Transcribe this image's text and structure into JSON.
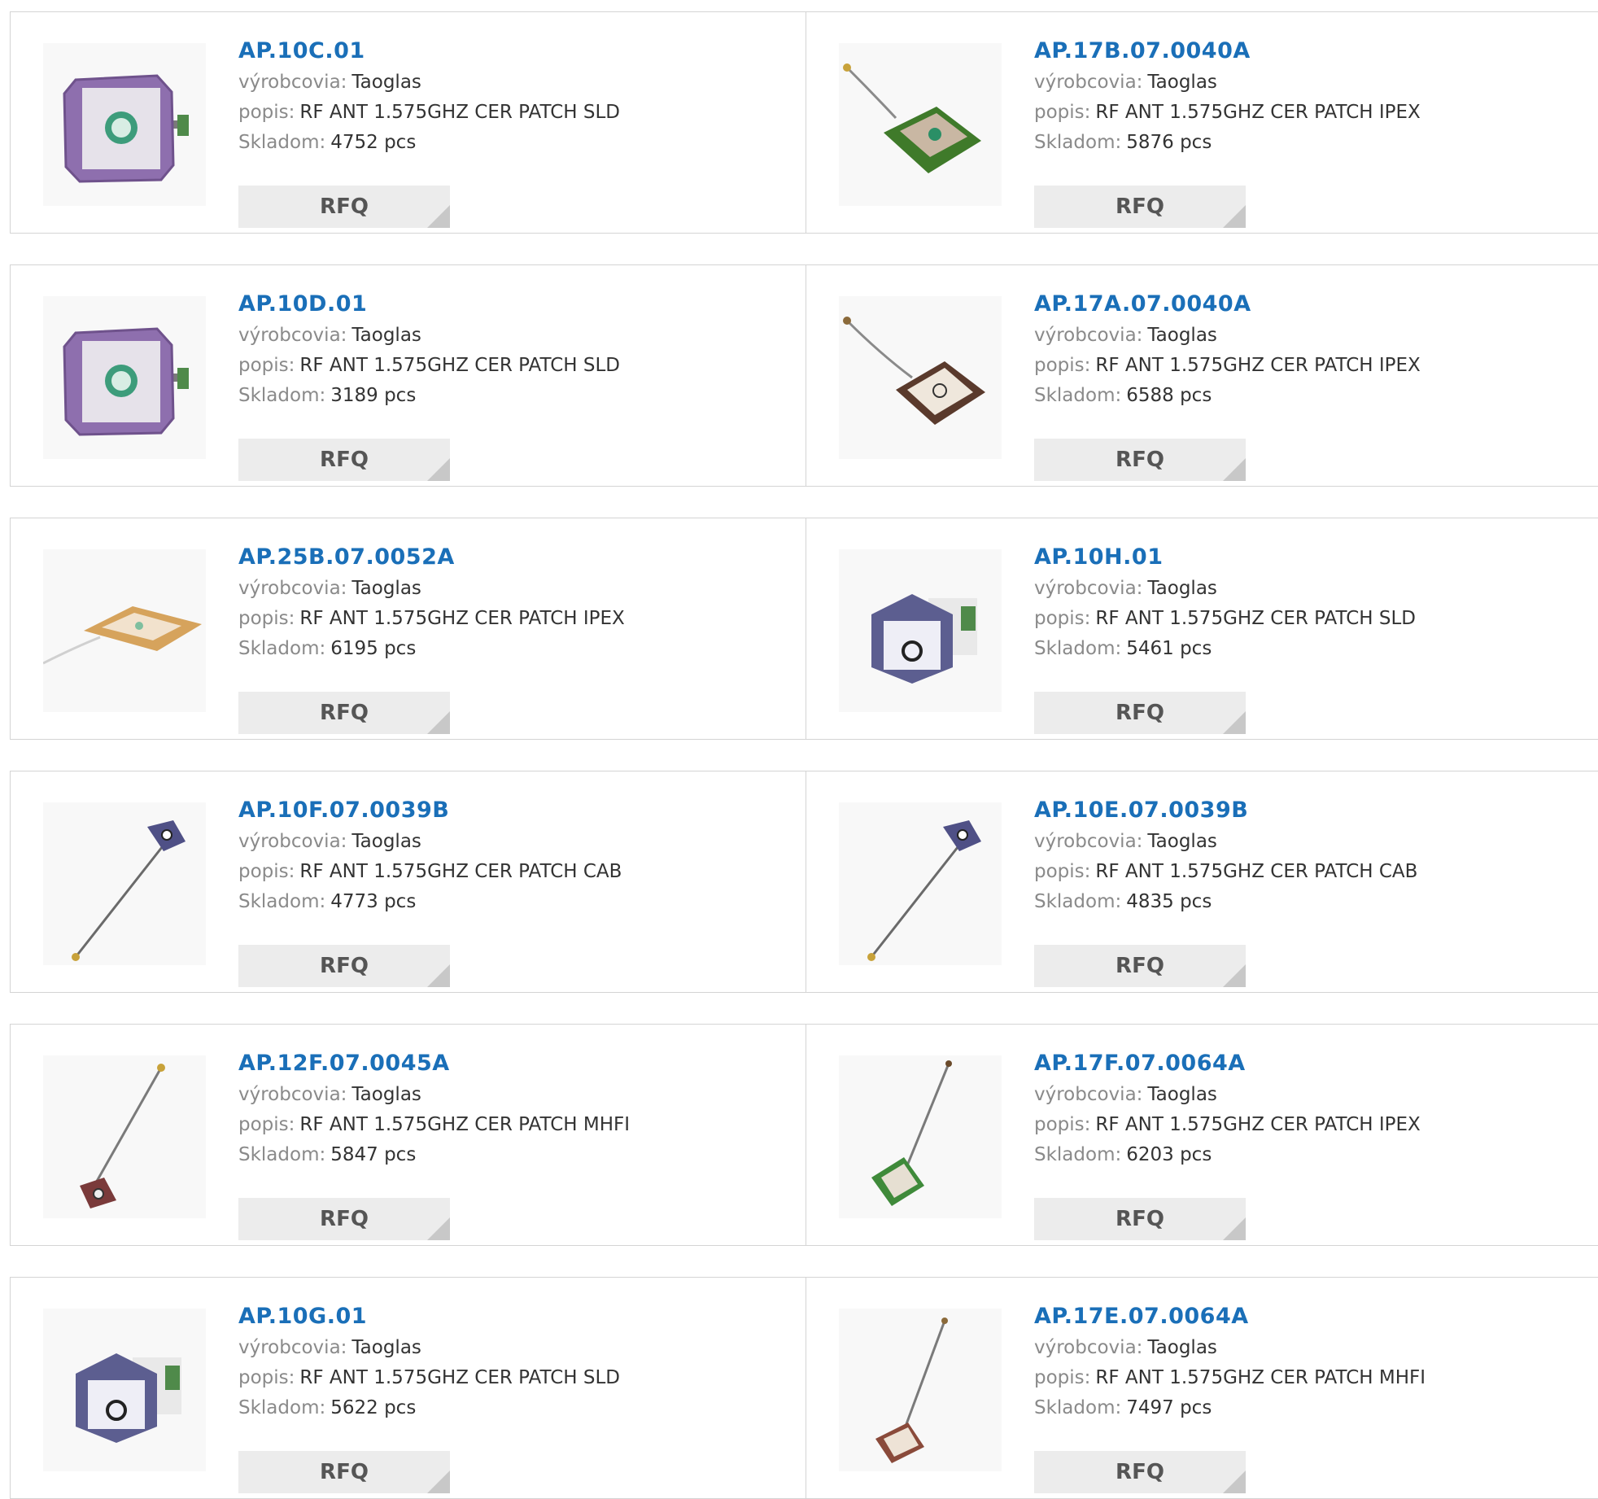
{
  "labels": {
    "manufacturer": "výrobcovia:",
    "description": "popis:",
    "stock": "Skladom:",
    "rfq": "RFQ"
  },
  "colors": {
    "title": "#1a6fb8",
    "label": "#8a8a8a",
    "button_bg": "#ececec"
  },
  "products": [
    {
      "title": "AP.10C.01",
      "manufacturer": "Taoglas",
      "description": "RF ANT 1.575GHZ CER PATCH SLD",
      "stock": "4752 pcs",
      "image": "purple-square-patch-antenna"
    },
    {
      "title": "AP.17B.07.0040A",
      "manufacturer": "Taoglas",
      "description": "RF ANT 1.575GHZ CER PATCH IPEX",
      "stock": "5876 pcs",
      "image": "green-patch-antenna-with-cable"
    },
    {
      "title": "AP.10D.01",
      "manufacturer": "Taoglas",
      "description": "RF ANT 1.575GHZ CER PATCH SLD",
      "stock": "3189 pcs",
      "image": "purple-square-patch-antenna"
    },
    {
      "title": "AP.17A.07.0040A",
      "manufacturer": "Taoglas",
      "description": "RF ANT 1.575GHZ CER PATCH IPEX",
      "stock": "6588 pcs",
      "image": "brown-patch-antenna-with-cable"
    },
    {
      "title": "AP.25B.07.0052A",
      "manufacturer": "Taoglas",
      "description": "RF ANT 1.575GHZ CER PATCH IPEX",
      "stock": "6195 pcs",
      "image": "flat-patch-antenna-with-white-cable"
    },
    {
      "title": "AP.10H.01",
      "manufacturer": "Taoglas",
      "description": "RF ANT 1.575GHZ CER PATCH SLD",
      "stock": "5461 pcs",
      "image": "blue-cube-patch-antenna"
    },
    {
      "title": "AP.10F.07.0039B",
      "manufacturer": "Taoglas",
      "description": "RF ANT 1.575GHZ CER PATCH CAB",
      "stock": "4773 pcs",
      "image": "small-blue-patch-with-long-cable"
    },
    {
      "title": "AP.10E.07.0039B",
      "manufacturer": "Taoglas",
      "description": "RF ANT 1.575GHZ CER PATCH CAB",
      "stock": "4835 pcs",
      "image": "small-blue-patch-with-long-cable"
    },
    {
      "title": "AP.12F.07.0045A",
      "manufacturer": "Taoglas",
      "description": "RF ANT 1.575GHZ CER PATCH MHFI",
      "stock": "5847 pcs",
      "image": "small-red-patch-with-long-cable"
    },
    {
      "title": "AP.17F.07.0064A",
      "manufacturer": "Taoglas",
      "description": "RF ANT 1.575GHZ CER PATCH IPEX",
      "stock": "6203 pcs",
      "image": "green-patch-with-long-cable"
    },
    {
      "title": "AP.10G.01",
      "manufacturer": "Taoglas",
      "description": "RF ANT 1.575GHZ CER PATCH SLD",
      "stock": "5622 pcs",
      "image": "blue-cube-patch-antenna"
    },
    {
      "title": "AP.17E.07.0064A",
      "manufacturer": "Taoglas",
      "description": "RF ANT 1.575GHZ CER PATCH MHFI",
      "stock": "7497 pcs",
      "image": "brown-patch-with-long-cable"
    }
  ]
}
